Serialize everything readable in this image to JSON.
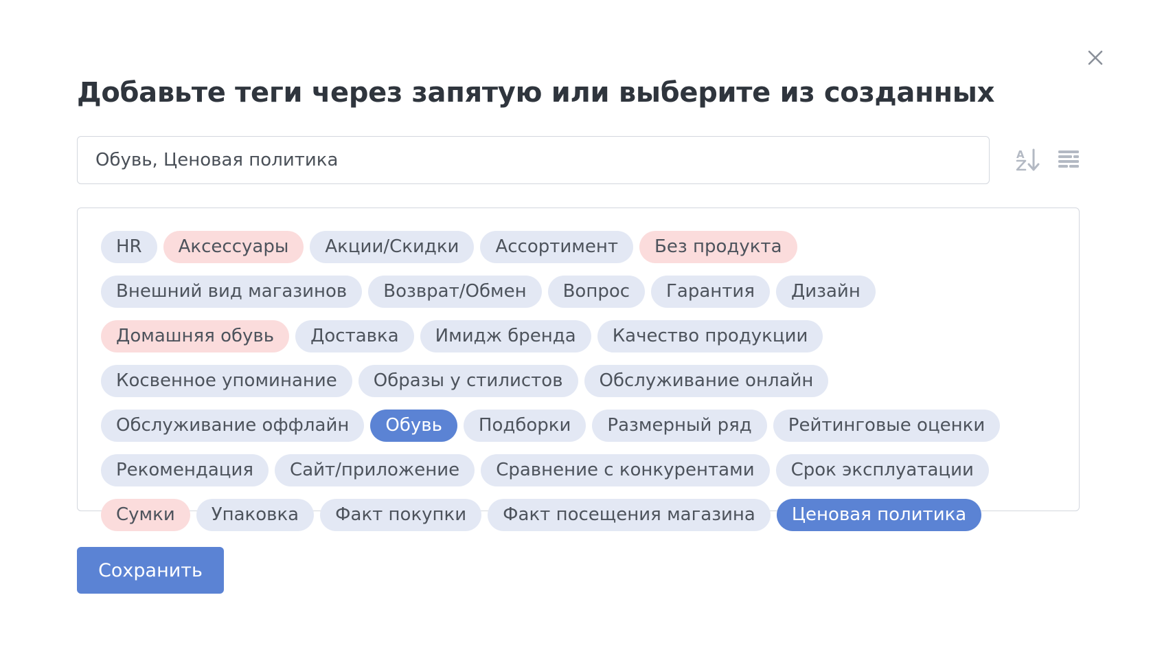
{
  "title": "Добавьте теги через запятую или выберите из созданных",
  "input": {
    "value": "Обувь, Ценовая политика"
  },
  "toolbar": {
    "sort_icon": "sort-alpha-down-icon",
    "list_icon": "list-align-icon"
  },
  "close_icon": "close-icon",
  "tags": [
    {
      "label": "HR",
      "state": "default"
    },
    {
      "label": "Аксессуары",
      "state": "pink"
    },
    {
      "label": "Акции/Скидки",
      "state": "default"
    },
    {
      "label": "Ассортимент",
      "state": "default"
    },
    {
      "label": "Без продукта",
      "state": "pink"
    },
    {
      "label": "Внешний вид магазинов",
      "state": "default"
    },
    {
      "label": "Возврат/Обмен",
      "state": "default"
    },
    {
      "label": "Вопрос",
      "state": "default"
    },
    {
      "label": "Гарантия",
      "state": "default"
    },
    {
      "label": "Дизайн",
      "state": "default"
    },
    {
      "label": "Домашняя обувь",
      "state": "pink"
    },
    {
      "label": "Доставка",
      "state": "default"
    },
    {
      "label": "Имидж бренда",
      "state": "default"
    },
    {
      "label": "Качество продукции",
      "state": "default"
    },
    {
      "label": "Косвенное упоминание",
      "state": "default"
    },
    {
      "label": "Образы у стилистов",
      "state": "default"
    },
    {
      "label": "Обслуживание онлайн",
      "state": "default"
    },
    {
      "label": "Обслуживание оффлайн",
      "state": "default"
    },
    {
      "label": "Обувь",
      "state": "selected"
    },
    {
      "label": "Подборки",
      "state": "default"
    },
    {
      "label": "Размерный ряд",
      "state": "default"
    },
    {
      "label": "Рейтинговые оценки",
      "state": "default"
    },
    {
      "label": "Рекомендация",
      "state": "default"
    },
    {
      "label": "Сайт/приложение",
      "state": "default"
    },
    {
      "label": "Сравнение с конкурентами",
      "state": "default"
    },
    {
      "label": "Срок эксплуатации",
      "state": "default"
    },
    {
      "label": "Сумки",
      "state": "pink"
    },
    {
      "label": "Упаковка",
      "state": "default"
    },
    {
      "label": "Факт покупки",
      "state": "default"
    },
    {
      "label": "Факт посещения магазина",
      "state": "default"
    },
    {
      "label": "Ценовая политика",
      "state": "selected"
    }
  ],
  "colors": {
    "tag_default_bg": "#e3e8f4",
    "tag_pink_bg": "#fbdcdc",
    "tag_selected_bg": "#5b83d4",
    "primary": "#5b83d4",
    "border": "#d3d7de",
    "title": "#2f353d"
  },
  "save_button": {
    "label": "Сохранить"
  }
}
